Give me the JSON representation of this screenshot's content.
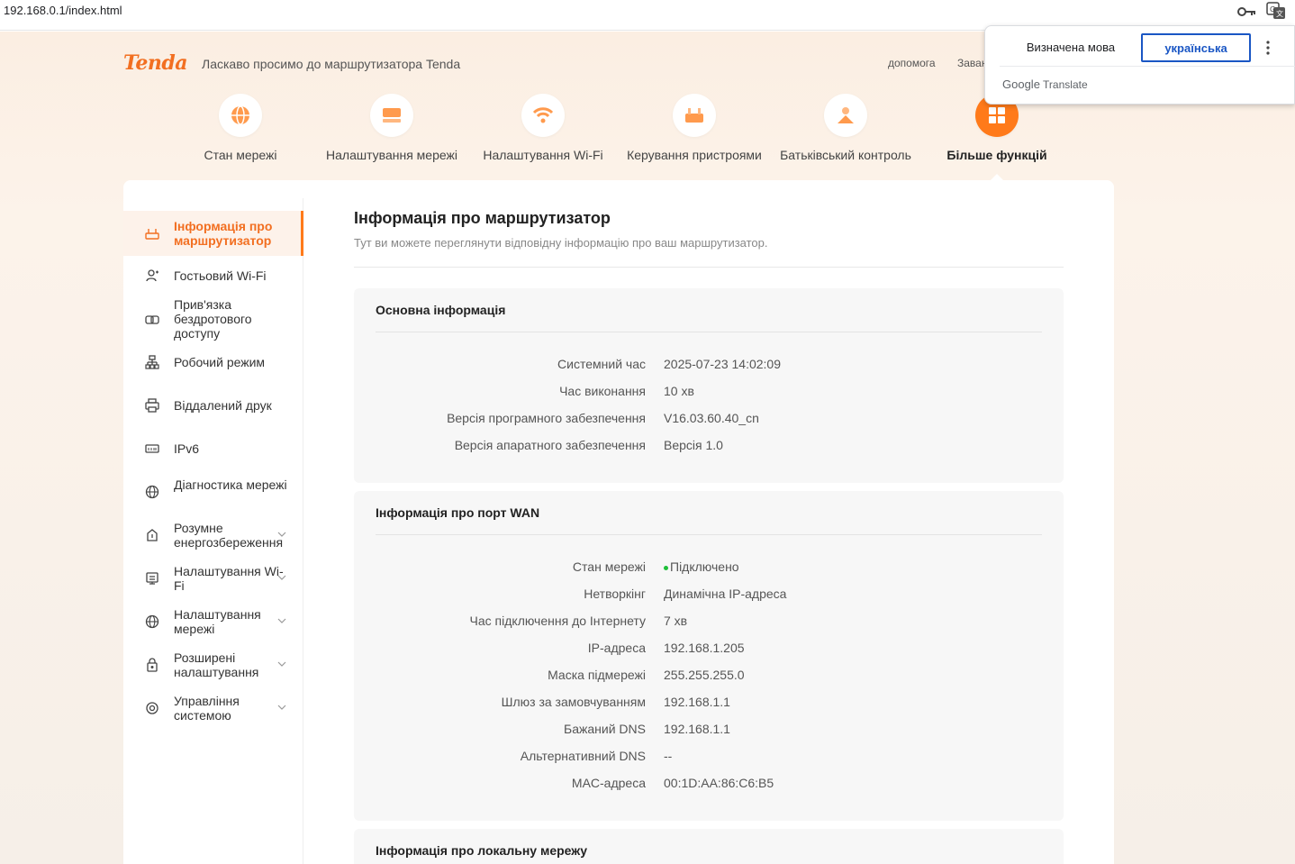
{
  "browser": {
    "url": "192.168.0.1/index.html"
  },
  "header": {
    "logo": "Tenda",
    "welcome": "Ласкаво просимо до маршрутизатора Tenda",
    "help": "допомога",
    "more": "Завантажити"
  },
  "topnav": [
    {
      "label": "Стан мережі",
      "icon": "globe-icon"
    },
    {
      "label": "Налаштування мережі",
      "icon": "network-icon"
    },
    {
      "label": "Налаштування Wi-Fi",
      "icon": "wifi-icon"
    },
    {
      "label": "Керування пристроями",
      "icon": "devices-icon"
    },
    {
      "label": "Батьківський контроль",
      "icon": "parental-icon"
    },
    {
      "label": "Більше функцій",
      "icon": "grid-icon",
      "active": true
    }
  ],
  "sidebar": [
    {
      "label": "Інформація про маршрутизатор",
      "icon": "router-icon",
      "active": true
    },
    {
      "label": "Гостьовий Wi-Fi",
      "icon": "guest-icon"
    },
    {
      "label": "Прив'язка бездротового доступу",
      "icon": "link-icon"
    },
    {
      "label": "Робочий режим",
      "icon": "mode-icon"
    },
    {
      "label": "Віддалений друк",
      "icon": "printer-icon"
    },
    {
      "label": "IPv6",
      "icon": "ipv6-icon"
    },
    {
      "label": "Діагностика мережі",
      "icon": "globe-icon"
    },
    {
      "label": "Розумне енергозбереження",
      "icon": "energy-icon",
      "expandable": true
    },
    {
      "label": "Налаштування Wi-Fi",
      "icon": "wifi-settings-icon",
      "expandable": true
    },
    {
      "label": "Налаштування мережі",
      "icon": "globe-icon",
      "expandable": true
    },
    {
      "label": "Розширені налаштування",
      "icon": "advanced-icon",
      "expandable": true
    },
    {
      "label": "Управління системою",
      "icon": "system-icon",
      "expandable": true
    }
  ],
  "main": {
    "title": "Інформація про маршрутизатор",
    "subtitle": "Тут ви можете переглянути відповідну інформацію про ваш маршрутизатор.",
    "sections": [
      {
        "title": "Основна інформація",
        "rows": [
          {
            "k": "Системний час",
            "v": "2025-07-23 14:02:09"
          },
          {
            "k": "Час виконання",
            "v": "10 хв"
          },
          {
            "k": "Версія програмного забезпечення",
            "v": "V16.03.60.40_cn"
          },
          {
            "k": "Версія апаратного забезпечення",
            "v": "Версія 1.0"
          }
        ]
      },
      {
        "title": "Інформація про порт WAN",
        "rows": [
          {
            "k": "Стан мережі",
            "v": "Підключено"
          },
          {
            "k": "Нетворкінг",
            "v": "Динамічна IP-адреса"
          },
          {
            "k": "Час підключення до Інтернету",
            "v": "7 хв"
          },
          {
            "k": "IP-адреса",
            "v": "192.168.1.205"
          },
          {
            "k": "Маска підмережі",
            "v": "255.255.255.0"
          },
          {
            "k": "Шлюз за замовчуванням",
            "v": "192.168.1.1"
          },
          {
            "k": "Бажаний DNS",
            "v": "192.168.1.1"
          },
          {
            "k": "Альтернативний DNS",
            "v": "--"
          },
          {
            "k": "MAC-адреса",
            "v": "00:1D:AA:86:C6:B5"
          }
        ]
      },
      {
        "title": "Інформація про локальну мережу",
        "rows": []
      }
    ]
  },
  "translate_popup": {
    "detected": "Визначена мова",
    "target": "українська",
    "brand_google": "Google",
    "brand_translate": "Translate"
  },
  "colors": {
    "accent": "#ff7a1a",
    "connected": "#1fbf3a",
    "translate_blue": "#1a56c4"
  }
}
